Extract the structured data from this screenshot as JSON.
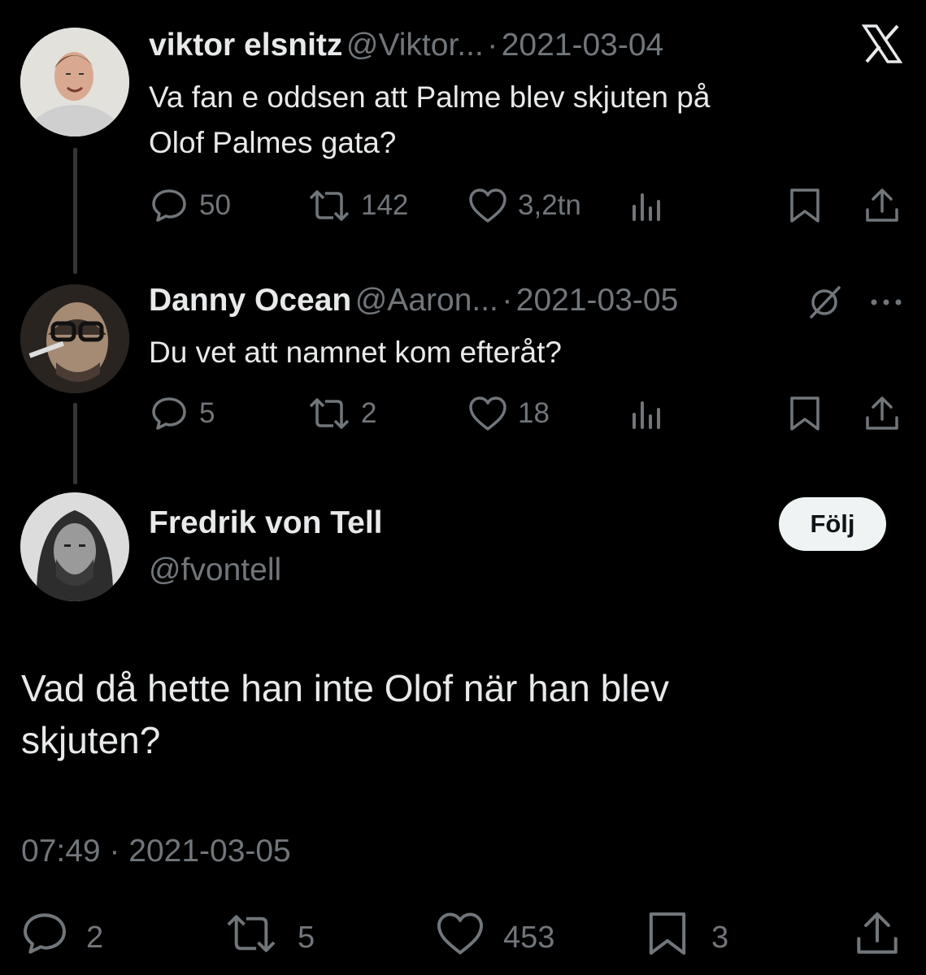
{
  "tweets": [
    {
      "name": "viktor elsnitz",
      "handle": "@Viktor...",
      "sep": "·",
      "date": "2021-03-04",
      "text_line1": "Va fan e oddsen att Palme blev skjuten på",
      "text_line2": "Olof Palmes gata?",
      "replies": "50",
      "retweets": "142",
      "likes": "3,2tn"
    },
    {
      "name": "Danny Ocean",
      "handle": "@Aaron...",
      "sep": "·",
      "date": "2021-03-05",
      "text_line1": "Du vet att namnet kom efteråt?",
      "replies": "5",
      "retweets": "2",
      "likes": "18"
    }
  ],
  "main": {
    "name": "Fredrik von Tell",
    "handle": "@fvontell",
    "follow_label": "Följ",
    "text_line1": "Vad då hette han inte Olof när han blev",
    "text_line2": "skjuten?",
    "timestamp": "07:49 · 2021-03-05",
    "replies": "2",
    "retweets": "5",
    "likes": "453",
    "bookmarks": "3"
  },
  "colors": {
    "background": "#000000",
    "text": "#e7e9ea",
    "secondary": "#71767b",
    "button_bg": "#eff3f4"
  },
  "icons": [
    "x-logo-icon",
    "reply-icon",
    "retweet-icon",
    "like-icon",
    "views-icon",
    "bookmark-icon",
    "share-icon",
    "grok-icon",
    "more-icon"
  ]
}
